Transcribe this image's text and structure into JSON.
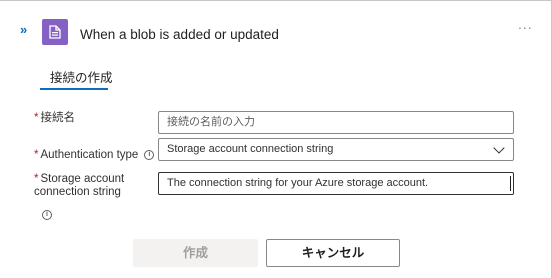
{
  "header": {
    "title": "When a blob is added or updated",
    "expand_glyph": "»",
    "more_glyph": "...",
    "icon": "storage-blob-icon",
    "icon_color": "#8661c5"
  },
  "tabs": [
    {
      "label": "接続の作成"
    }
  ],
  "form": {
    "connection_name": {
      "label": "接続名",
      "placeholder": "接続の名前の入力",
      "required": "*"
    },
    "auth_type": {
      "label": "Authentication type",
      "value": "Storage account connection string",
      "required": "*"
    },
    "connection_string": {
      "label_line1": "Storage account",
      "label_line2": "connection string",
      "value": "The connection string for your Azure storage account.",
      "required": "*"
    },
    "info_glyph": "i"
  },
  "buttons": {
    "create": "作成",
    "cancel": "キャンセル"
  },
  "colors": {
    "accent": "#0f6cbd",
    "required": "#a4262c"
  }
}
